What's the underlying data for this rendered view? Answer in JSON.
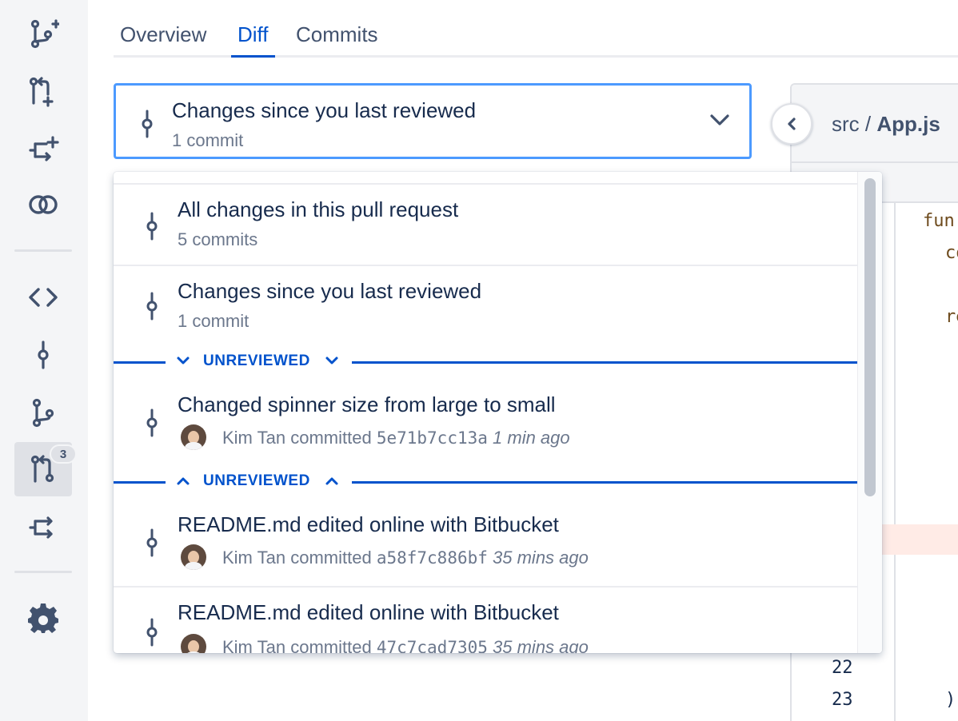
{
  "sidebar": {
    "items": [
      {
        "icon": "branch-create-icon"
      },
      {
        "icon": "pull-request-create-icon"
      },
      {
        "icon": "fork-create-icon"
      },
      {
        "icon": "compare-icon"
      },
      {
        "icon": "source-code-icon"
      },
      {
        "icon": "commits-icon"
      },
      {
        "icon": "branches-icon"
      },
      {
        "icon": "pull-requests-icon",
        "badge": "3"
      },
      {
        "icon": "forks-icon"
      },
      {
        "icon": "settings-icon"
      }
    ]
  },
  "tabs": [
    {
      "label": "Overview"
    },
    {
      "label": "Diff"
    },
    {
      "label": "Commits"
    }
  ],
  "active_tab": "Diff",
  "selector": {
    "title": "Changes since you last reviewed",
    "subtitle": "1 commit"
  },
  "dropdown": {
    "items": [
      {
        "title": "All changes in this pull request",
        "subtitle": "5 commits"
      },
      {
        "title": "Changes since you last reviewed",
        "subtitle": "1 commit"
      }
    ],
    "unreviewed_label": "UNREVIEWED",
    "commits": [
      {
        "title": "Changed spinner size from large to small",
        "author": "Kim Tan",
        "verb": "committed",
        "hash": "5e71b7cc13a",
        "time": "1 min ago"
      },
      {
        "title": "README.md edited online with Bitbucket",
        "author": "Kim Tan",
        "verb": "committed",
        "hash": "a58f7c886bf",
        "time": "35 mins ago"
      },
      {
        "title": "README.md edited online with Bitbucket",
        "author": "Kim Tan",
        "verb": "committed",
        "hash": "47c7cad7305",
        "time": "35 mins ago"
      }
    ]
  },
  "file": {
    "dir": "src",
    "separator": "/",
    "name": "App.js",
    "code": [
      "fun",
      "co",
      "re",
      ")"
    ],
    "line_numbers": [
      "22",
      "23"
    ]
  },
  "colors": {
    "accent": "#0052cc",
    "focus_border": "#4c9aff",
    "text": "#172b4d",
    "subtle_text": "#6b778c",
    "sidebar_bg": "#f4f5f7",
    "removed_line_bg": "#ffebe6"
  }
}
